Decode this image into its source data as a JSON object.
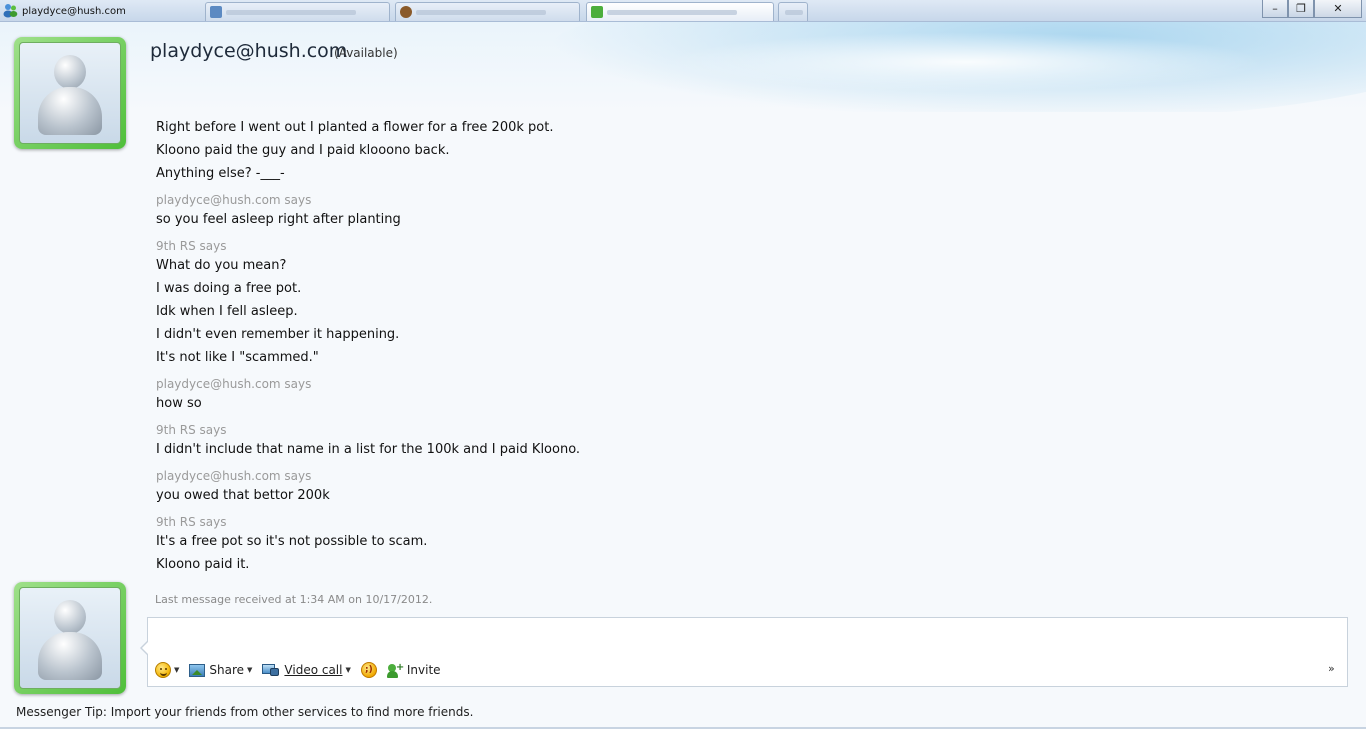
{
  "window": {
    "title": "playdyce@hush.com",
    "tabs": [
      {
        "label": "playdyce@hush.com",
        "active": false
      },
      {
        "label": "",
        "active": false
      },
      {
        "label": "",
        "active": false
      },
      {
        "label": "",
        "active": true
      },
      {
        "label": "",
        "active": false
      }
    ],
    "controls": {
      "minimize": "–",
      "restore": "❐",
      "close": "✕"
    }
  },
  "contact": {
    "name": "playdyce@hush.com",
    "status": "(Available)"
  },
  "conversation": {
    "blocks": [
      {
        "sender": "",
        "lines": [
          "Right before I went out I planted a flower for a free 200k pot.",
          "Kloono paid the guy and I paid klooono back.",
          "Anything else? -___-"
        ]
      },
      {
        "sender": "playdyce@hush.com says",
        "lines": [
          "so you feel asleep right after planting"
        ]
      },
      {
        "sender": "9th RS says",
        "lines": [
          "What do you mean?",
          "I was doing a free pot.",
          "Idk when I fell asleep.",
          "I didn't even remember it happening.",
          "It's not like I \"scammed.\""
        ]
      },
      {
        "sender": "playdyce@hush.com says",
        "lines": [
          "how so"
        ]
      },
      {
        "sender": "9th RS says",
        "lines": [
          "I didn't include that name in a list for the 100k and I paid Kloono."
        ]
      },
      {
        "sender": "playdyce@hush.com says",
        "lines": [
          "you owed that bettor 200k"
        ]
      },
      {
        "sender": "9th RS says",
        "lines": [
          "It's a free pot so it's not possible to scam.",
          "Kloono paid it."
        ]
      }
    ],
    "last_message": "Last message received at 1:34 AM on 10/17/2012."
  },
  "composer": {
    "value": "",
    "placeholder": ""
  },
  "toolbar": {
    "share_label": "Share",
    "video_call_label": "Video call",
    "invite_label": "Invite",
    "more_label": "»"
  },
  "tip": "Messenger Tip: Import your friends from other services to find more friends.",
  "colors": {
    "avatar_frame": "#4fbf3a",
    "sender_text": "#9a9a9a",
    "message_text": "#111111"
  }
}
